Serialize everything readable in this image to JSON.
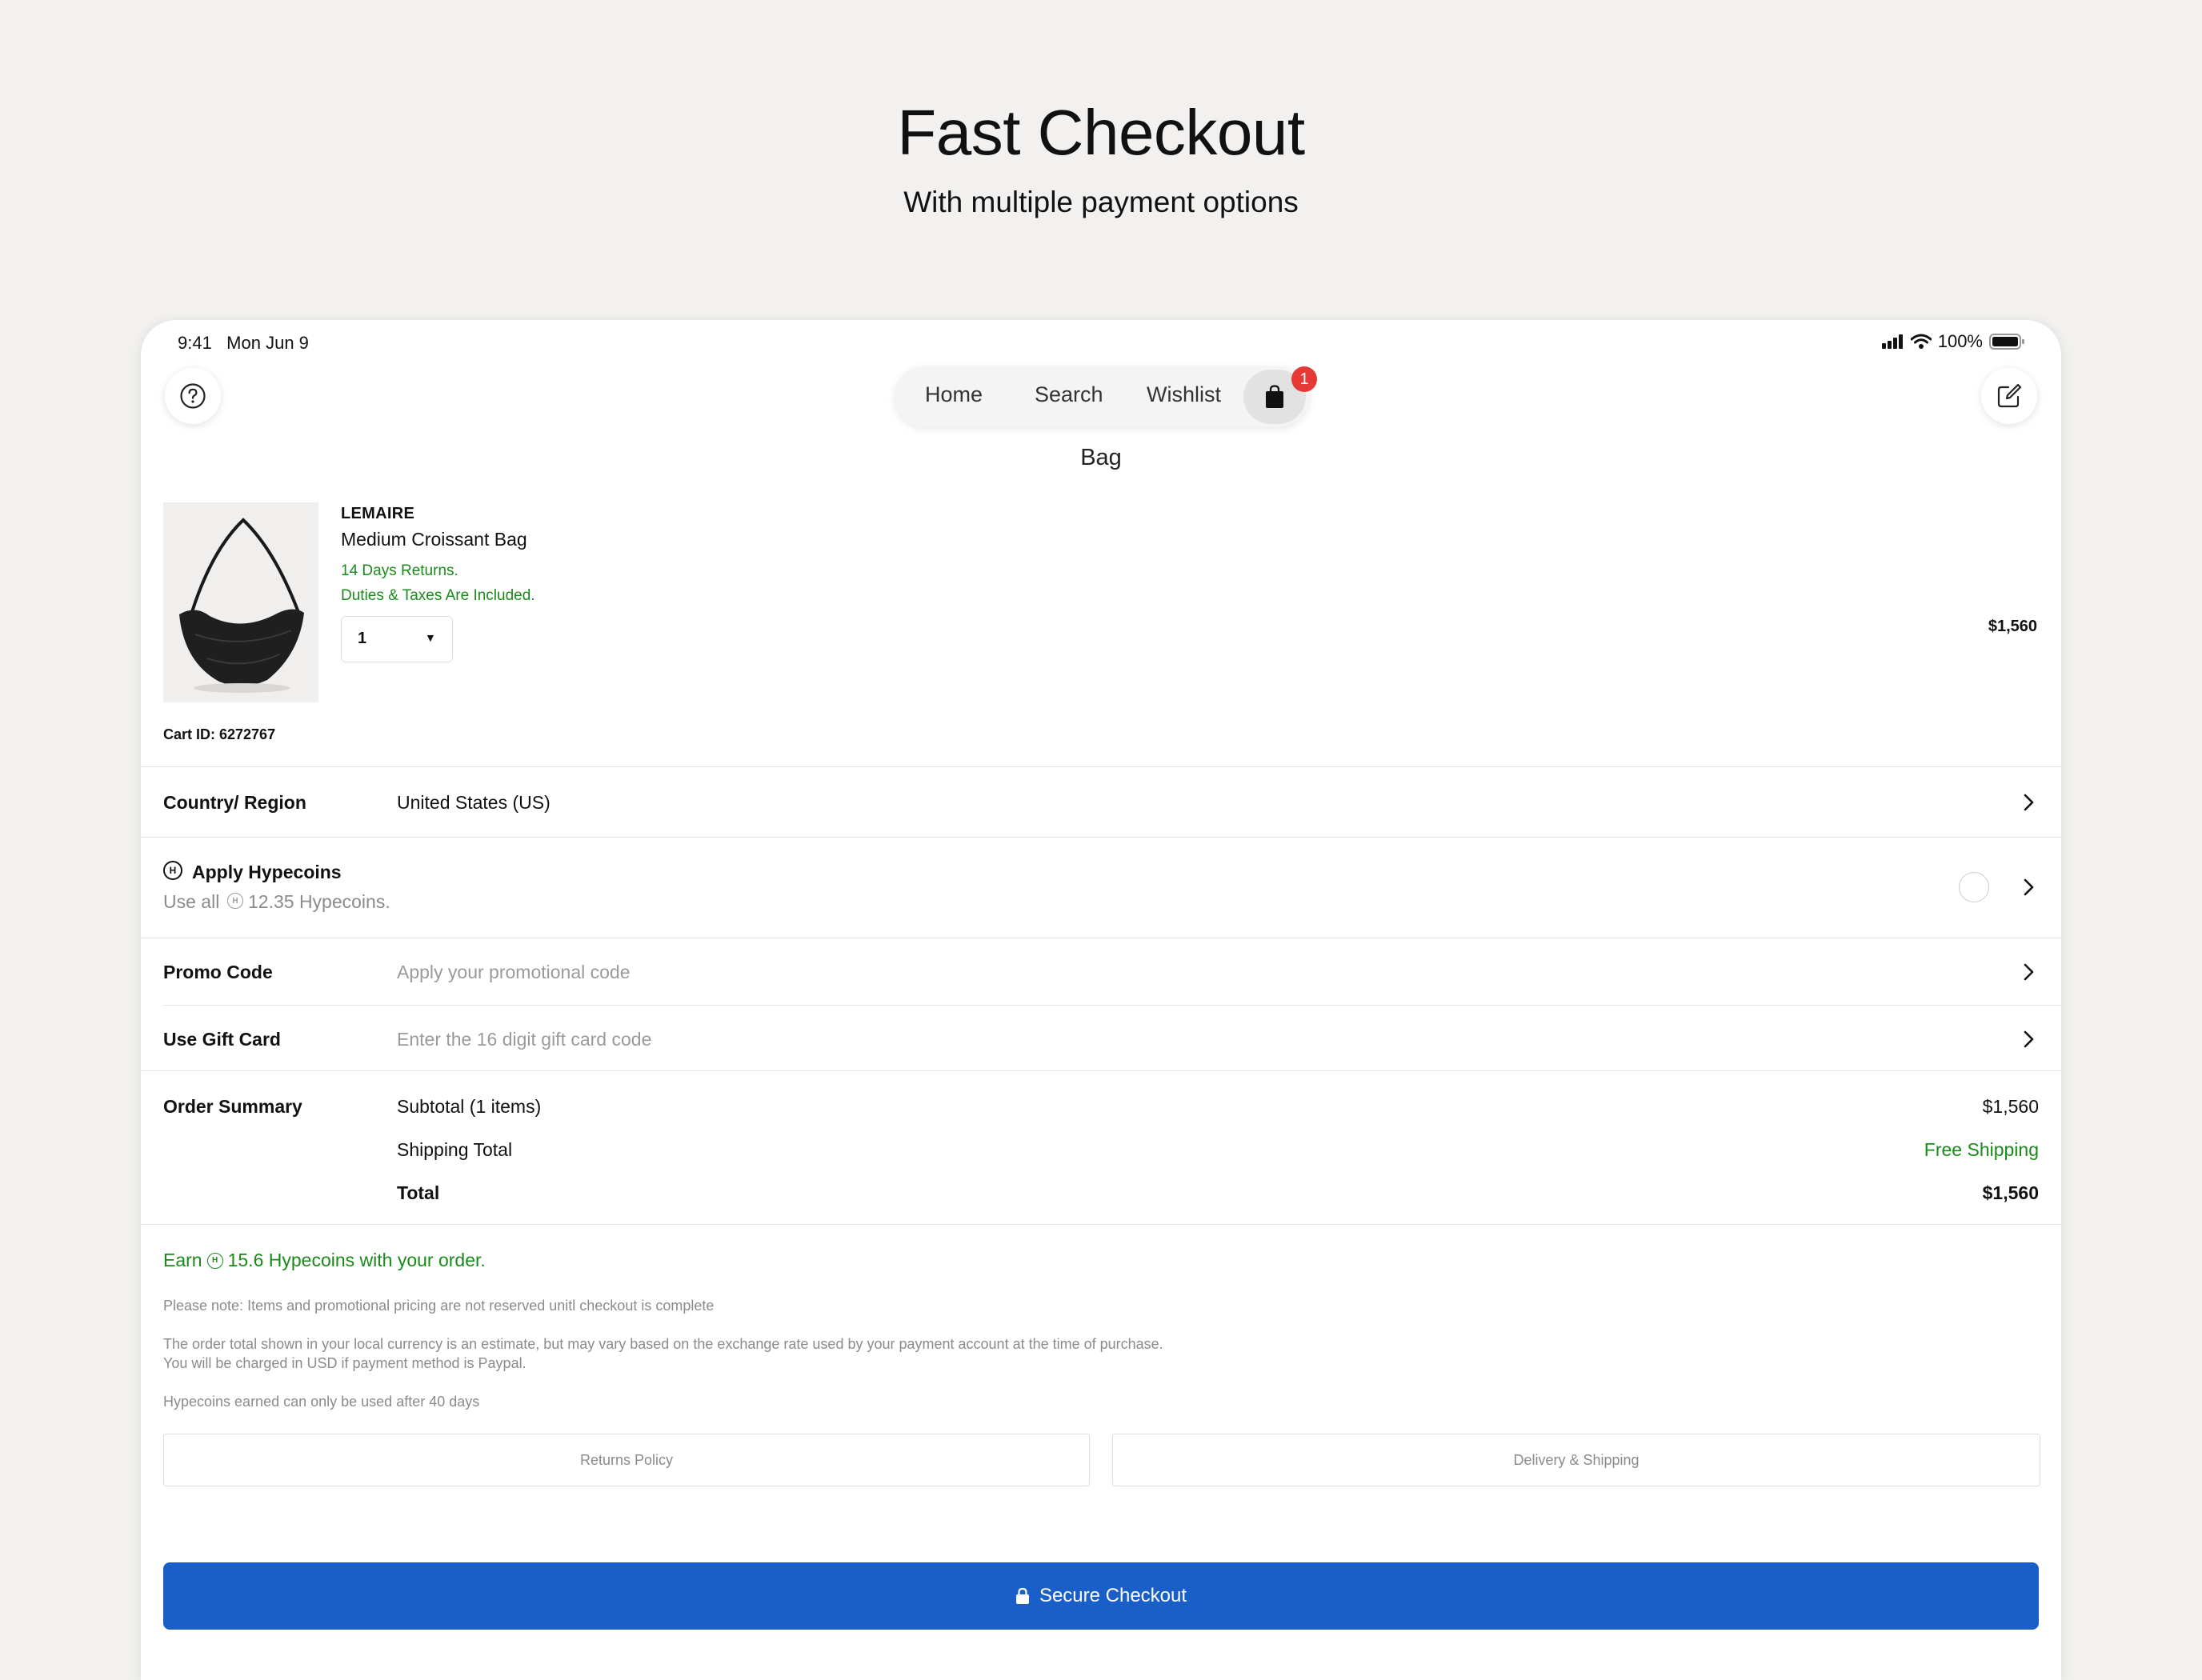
{
  "hero": {
    "title": "Fast Checkout",
    "subtitle": "With multiple payment options"
  },
  "status_bar": {
    "time": "9:41",
    "date": "Mon Jun 9",
    "battery": "100%"
  },
  "nav": {
    "tabs": [
      "Home",
      "Search",
      "Wishlist"
    ],
    "bag_badge": "1",
    "page_title": "Bag"
  },
  "product": {
    "brand": "LEMAIRE",
    "name": "Medium Croissant Bag",
    "returns": "14 Days Returns.",
    "duties": "Duties & Taxes Are Included.",
    "quantity": "1",
    "price": "$1,560",
    "cart_id": "Cart ID: 6272767"
  },
  "rows": {
    "country_label": "Country/ Region",
    "country_value": "United States (US)",
    "hypecoins_label": "Apply Hypecoins",
    "hypecoins_sub_prefix": "Use all",
    "hypecoins_sub_amount": "12.35 Hypecoins.",
    "promo_label": "Promo Code",
    "promo_placeholder": "Apply your promotional code",
    "gift_label": "Use Gift Card",
    "gift_placeholder": "Enter the 16 digit gift card code"
  },
  "summary": {
    "label": "Order Summary",
    "subtotal_label": "Subtotal (1 items)",
    "subtotal_value": "$1,560",
    "shipping_label": "Shipping Total",
    "shipping_value": "Free Shipping",
    "total_label": "Total",
    "total_value": "$1,560"
  },
  "earn": {
    "prefix": "Earn",
    "amount": "15.6 Hypecoins with your order."
  },
  "notes": {
    "note1": "Please note: Items and promotional pricing are not reserved unitl checkout is complete",
    "note2a": "The order total shown in your local currency is an estimate, but may vary based on the exchange rate used by your payment account at the time of purchase.",
    "note2b": "You will be charged in USD if payment method is Paypal.",
    "note3": "Hypecoins earned can only be used after 40 days"
  },
  "buttons": {
    "returns": "Returns Policy",
    "delivery": "Delivery & Shipping",
    "checkout": "Secure Checkout"
  },
  "colors": {
    "accent_blue": "#1a5fc8",
    "green": "#1a8a1a",
    "badge_red": "#e53935",
    "background": "#f2f1ef"
  },
  "icons": {
    "help": "question-circle-icon",
    "compose": "compose-icon",
    "bag": "shopping-bag-icon",
    "chevron": "chevron-right-icon",
    "lock": "lock-icon",
    "coin": "hypecoin-icon"
  }
}
